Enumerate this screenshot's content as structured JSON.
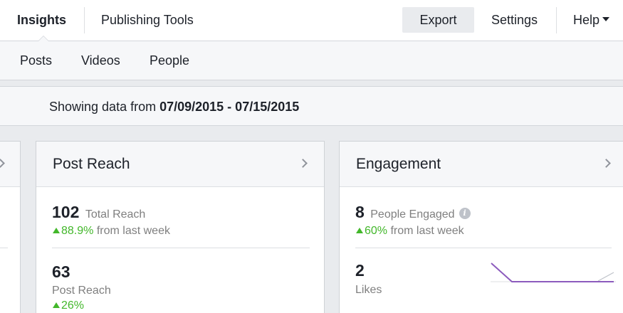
{
  "topbar": {
    "tabs": [
      {
        "label": "Insights",
        "active": true
      },
      {
        "label": "Publishing Tools",
        "active": false
      }
    ],
    "export_label": "Export",
    "settings_label": "Settings",
    "help_label": "Help"
  },
  "subnav": {
    "items": [
      {
        "label": "Posts"
      },
      {
        "label": "Videos"
      },
      {
        "label": "People"
      }
    ]
  },
  "databar": {
    "prefix": "Showing data from ",
    "range": "07/09/2015 - 07/15/2015"
  },
  "cards": {
    "post_reach": {
      "title": "Post Reach",
      "total_value": "102",
      "total_label": "Total Reach",
      "total_change": "88.9%",
      "total_change_suffix": " from last week",
      "post_value": "63",
      "post_label": "Post Reach",
      "post_change": "26%"
    },
    "engagement": {
      "title": "Engagement",
      "people_value": "8",
      "people_label": "People Engaged",
      "people_change": "60%",
      "people_change_suffix": " from last week",
      "likes_value": "2",
      "likes_label": "Likes",
      "info_icon": "i"
    }
  },
  "colors": {
    "positive": "#42b72a",
    "sparkline": "#8c5bbd",
    "sparkline_secondary": "#bec2c9"
  },
  "icons": [
    "chevron-right-icon",
    "caret-down-icon",
    "info-icon",
    "triangle-up-icon"
  ]
}
